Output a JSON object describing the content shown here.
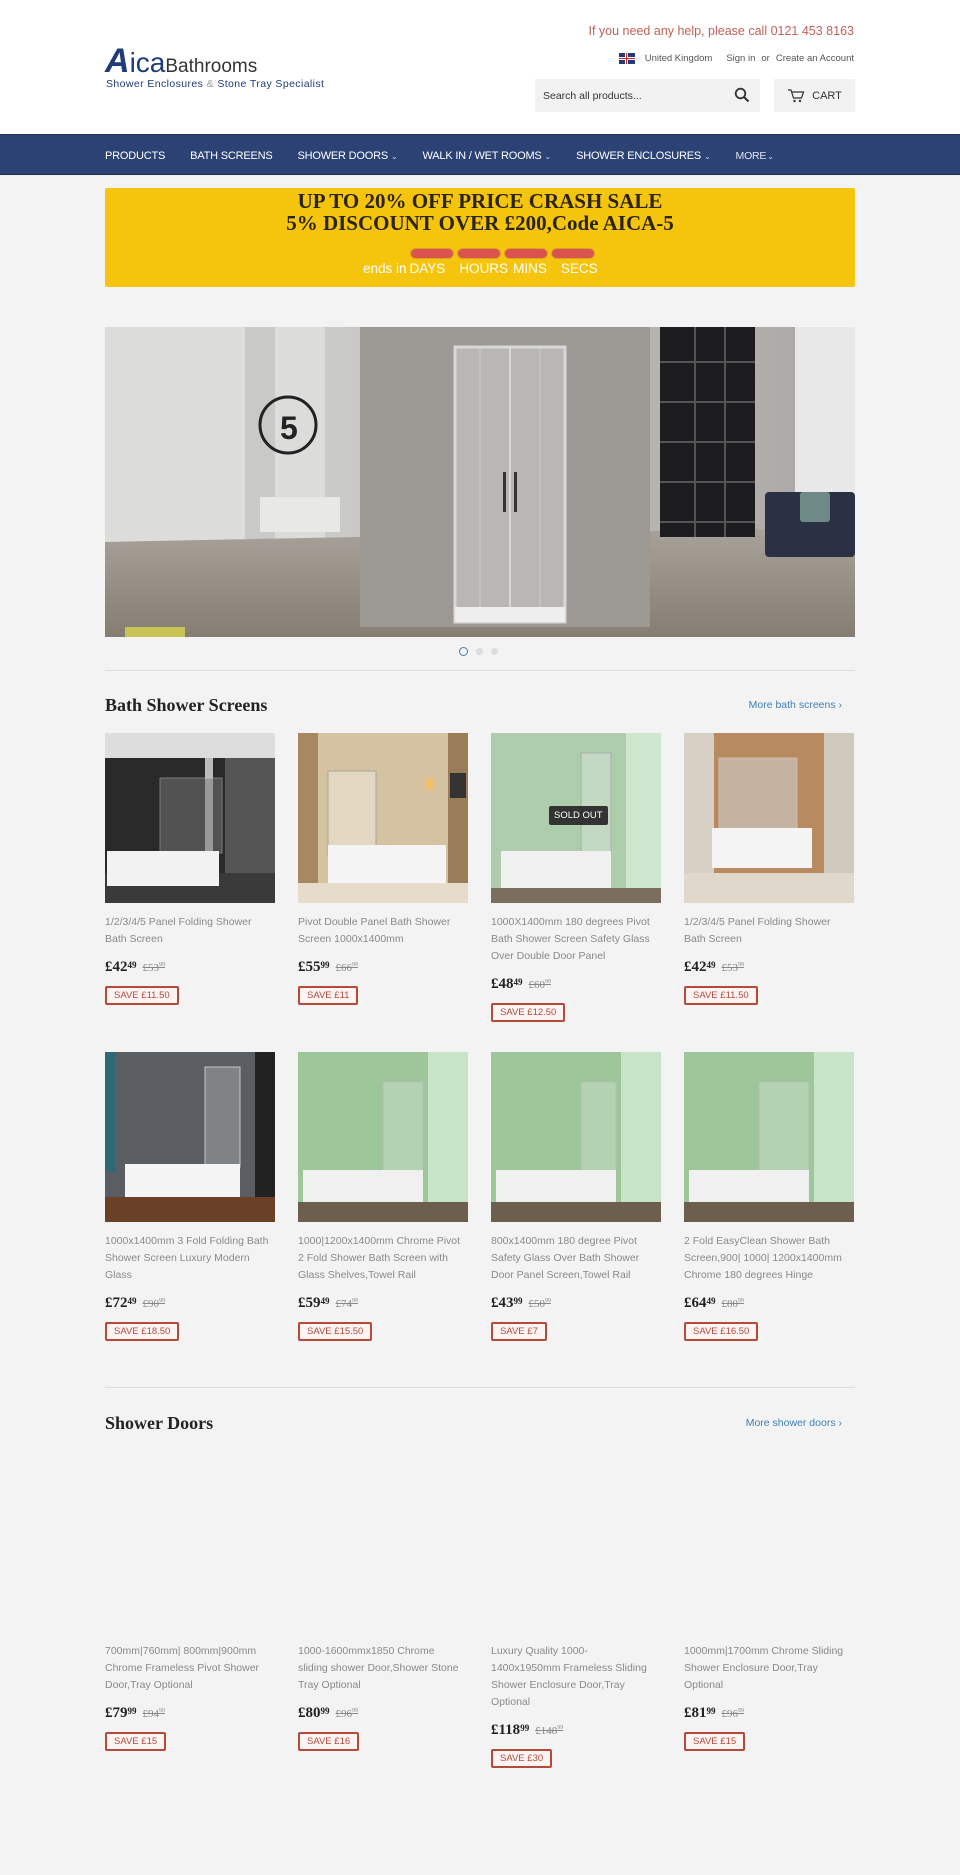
{
  "header": {
    "logo": {
      "brand_a": "A",
      "brand_ica": "ica",
      "brand_rest": "Bathrooms",
      "tagline_1": "Shower Enclosures",
      "tagline_amp": "&",
      "tagline_2": "Stone Tray Specialist"
    },
    "help_text": "If you need any help, please call 0121 453 8163",
    "country": "United Kingdom",
    "sign_in": "Sign in",
    "or": "or",
    "create_account": "Create an Account",
    "search_placeholder": "Search all products...",
    "cart_label": "CART"
  },
  "nav": {
    "items": [
      {
        "label": "PRODUCTS",
        "dropdown": false
      },
      {
        "label": "BATH SCREENS",
        "dropdown": false
      },
      {
        "label": "SHOWER DOORS",
        "dropdown": true
      },
      {
        "label": "WALK IN / WET ROOMS",
        "dropdown": true
      },
      {
        "label": "SHOWER ENCLOSURES",
        "dropdown": true
      },
      {
        "label": "MORE",
        "dropdown": true
      }
    ],
    "chevron": "⌄"
  },
  "promo": {
    "line1": "UP TO 20% OFF PRICE CRASH SALE",
    "line2": "5% DISCOUNT OVER £200,Code AICA-5",
    "ends_in": "ends in",
    "labels": [
      "DAYS",
      "HOURS",
      "MINS",
      "SECS"
    ],
    "colors": {
      "background": "#f5c50e",
      "timer": "#d9534f"
    }
  },
  "hero": {
    "slides": 3,
    "active_slide": 1
  },
  "sections": [
    {
      "title": "Bath Shower Screens",
      "more_link": "More bath screens ›",
      "products": [
        {
          "title": "1/2/3/4/5 Panel Folding Shower Bath Screen",
          "price_main": "£42",
          "price_cents": "49",
          "old_main": "£53",
          "old_cents": "99",
          "save": "SAVE £11.50",
          "sold_out": false
        },
        {
          "title": "Pivot Double Panel Bath Shower Screen 1000x1400mm",
          "price_main": "£55",
          "price_cents": "99",
          "old_main": "£66",
          "old_cents": "99",
          "save": "SAVE £11",
          "sold_out": false
        },
        {
          "title": "1000X1400mm 180 degrees Pivot Bath Shower Screen Safety Glass Over Double Door Panel",
          "price_main": "£48",
          "price_cents": "49",
          "old_main": "£60",
          "old_cents": "99",
          "save": "SAVE £12.50",
          "sold_out": true,
          "sold_out_label": "SOLD OUT"
        },
        {
          "title": "1/2/3/4/5 Panel Folding Shower Bath Screen",
          "price_main": "£42",
          "price_cents": "49",
          "old_main": "£53",
          "old_cents": "99",
          "save": "SAVE £11.50",
          "sold_out": false
        },
        {
          "title": "1000x1400mm 3 Fold Folding Bath Shower Screen Luxury Modern Glass",
          "price_main": "£72",
          "price_cents": "49",
          "old_main": "£90",
          "old_cents": "99",
          "save": "SAVE £18.50",
          "sold_out": false
        },
        {
          "title": "1000|1200x1400mm Chrome Pivot 2 Fold Shower Bath Screen with Glass Shelves,Towel Rail",
          "price_main": "£59",
          "price_cents": "49",
          "old_main": "£74",
          "old_cents": "99",
          "save": "SAVE £15.50",
          "sold_out": false
        },
        {
          "title": "800x1400mm 180 degree Pivot Safety Glass Over Bath Shower Door Panel Screen,Towel Rail",
          "price_main": "£43",
          "price_cents": "99",
          "old_main": "£50",
          "old_cents": "99",
          "save": "SAVE £7",
          "sold_out": false
        },
        {
          "title": "2 Fold EasyClean Shower Bath Screen,900| 1000| 1200x1400mm Chrome 180 degrees Hinge",
          "price_main": "£64",
          "price_cents": "49",
          "old_main": "£80",
          "old_cents": "99",
          "save": "SAVE £16.50",
          "sold_out": false
        }
      ]
    },
    {
      "title": "Shower Doors",
      "more_link": "More shower doors ›",
      "products": [
        {
          "title": "700mm|760mm| 800mm|900mm Chrome Frameless Pivot Shower Door,Tray Optional",
          "price_main": "£79",
          "price_cents": "99",
          "old_main": "£94",
          "old_cents": "99",
          "save": "SAVE £15"
        },
        {
          "title": "1000-1600mmx1850 Chrome sliding shower Door,Shower Stone Tray Optional",
          "price_main": "£80",
          "price_cents": "99",
          "old_main": "£96",
          "old_cents": "99",
          "save": "SAVE £16"
        },
        {
          "title": "Luxury Quality 1000-1400x1950mm Frameless Sliding Shower Enclosure Door,Tray Optional",
          "price_main": "£118",
          "price_cents": "99",
          "old_main": "£148",
          "old_cents": "99",
          "save": "SAVE £30"
        },
        {
          "title": "1000mm|1700mm Chrome Sliding Shower Enclosure Door,Tray Optional",
          "price_main": "£81",
          "price_cents": "99",
          "old_main": "£96",
          "old_cents": "99",
          "save": "SAVE £15"
        }
      ]
    }
  ],
  "colors": {
    "nav": "#2c4275",
    "accent_link": "#3d7fb5",
    "save_badge": "#b34a3a",
    "help_text": "#c0625a"
  }
}
